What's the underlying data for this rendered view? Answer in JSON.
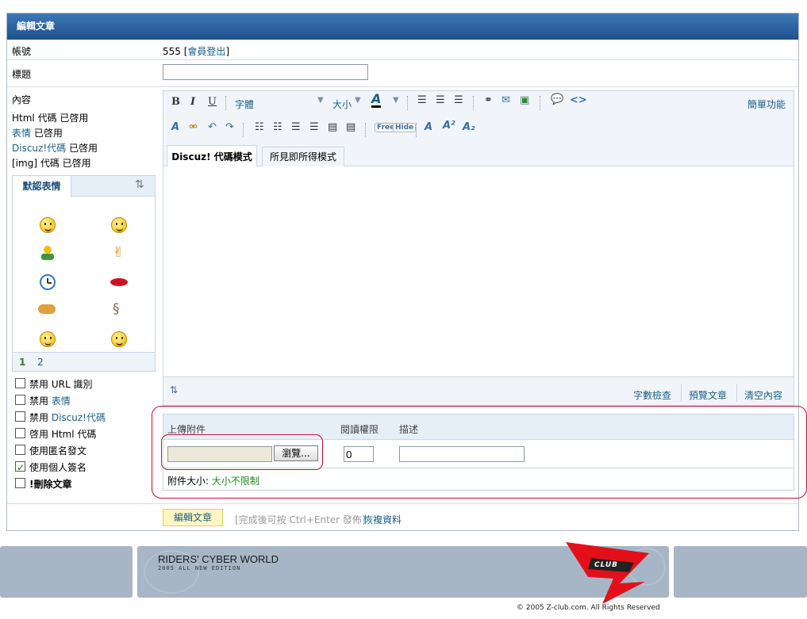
{
  "panel": {
    "title": "編輯文章"
  },
  "account": {
    "label": "帳號",
    "username": "555",
    "bracket_open": "[",
    "logout_link": "會員登出",
    "bracket_close": "]"
  },
  "title_row": {
    "label": "標題",
    "value": ""
  },
  "content": {
    "label": "內容",
    "status": [
      {
        "name": "Html 代碼",
        "state": "已啓用",
        "is_link": false
      },
      {
        "name": "表情",
        "state": "已啓用",
        "is_link": true
      },
      {
        "name": "Discuz!代碼",
        "state": "已啓用",
        "is_link": true
      },
      {
        "name": "[img] 代碼",
        "state": "已啓用",
        "is_link": false
      }
    ]
  },
  "smilies": {
    "tab_label": "默認表情",
    "pages": [
      "1",
      "2"
    ],
    "current_page": "1",
    "icons": [
      "smile-icon",
      "grin-icon",
      "person-icon",
      "victory-hand-icon",
      "clock-icon",
      "lips-icon",
      "handshake-icon",
      "snail-icon",
      "blush-icon",
      "laugh-icon"
    ]
  },
  "editor": {
    "font_label": "字體",
    "size_label": "大小",
    "simple_mode_link": "簡單功能",
    "free_label": "Free",
    "hide_label": "Hide",
    "tabs": [
      "Discuz! 代碼模式",
      "所見即所得模式"
    ],
    "active_tab": 0,
    "body_text": "",
    "bottom_links": [
      "字數檢查",
      "預覽文章",
      "清空內容"
    ]
  },
  "options": [
    {
      "prefix": "禁用",
      "text": " URL 識別",
      "link": "",
      "checked": false,
      "bold": false
    },
    {
      "prefix": "禁用",
      "text": "",
      "link": "表情",
      "checked": false,
      "bold": false
    },
    {
      "prefix": "禁用",
      "text": "",
      "link": "Discuz!代碼",
      "checked": false,
      "bold": false
    },
    {
      "prefix": "啓用",
      "text": " Html 代碼",
      "link": "",
      "checked": false,
      "bold": false
    },
    {
      "prefix": "使用",
      "text": "匿名發文",
      "link": "",
      "checked": false,
      "bold": false
    },
    {
      "prefix": "使用",
      "text": "個人簽名",
      "link": "",
      "checked": true,
      "bold": false
    },
    {
      "prefix": "!",
      "text": "刪除文章",
      "link": "",
      "checked": false,
      "bold": true
    }
  ],
  "attachment": {
    "col_upload": "上傳附件",
    "col_permission": "閱讀權限",
    "col_description": "描述",
    "browse_label": "瀏覽...",
    "permission_value": "0",
    "description_value": "",
    "size_label": "附件大小:",
    "size_value": "大小不限制"
  },
  "submit": {
    "button_label": "編輯文章",
    "hint": "[完成後可按 Ctrl+Enter 發佈]",
    "restore_link": "恢複資料"
  },
  "footer": {
    "brand_title": "RIDERS' CYBER WORLD",
    "brand_subtitle": "2005 ALL NEW EDITION",
    "logo_text": "CLUB",
    "copyright": "© 2005 Z-club.com. All Rights Reserved"
  },
  "colors": {
    "title_bar": "#2a5fa0",
    "link": "#1a5f8c",
    "green": "#1f8a1f",
    "annotation_red": "#c8102e",
    "footer": "#a7b6c6"
  }
}
